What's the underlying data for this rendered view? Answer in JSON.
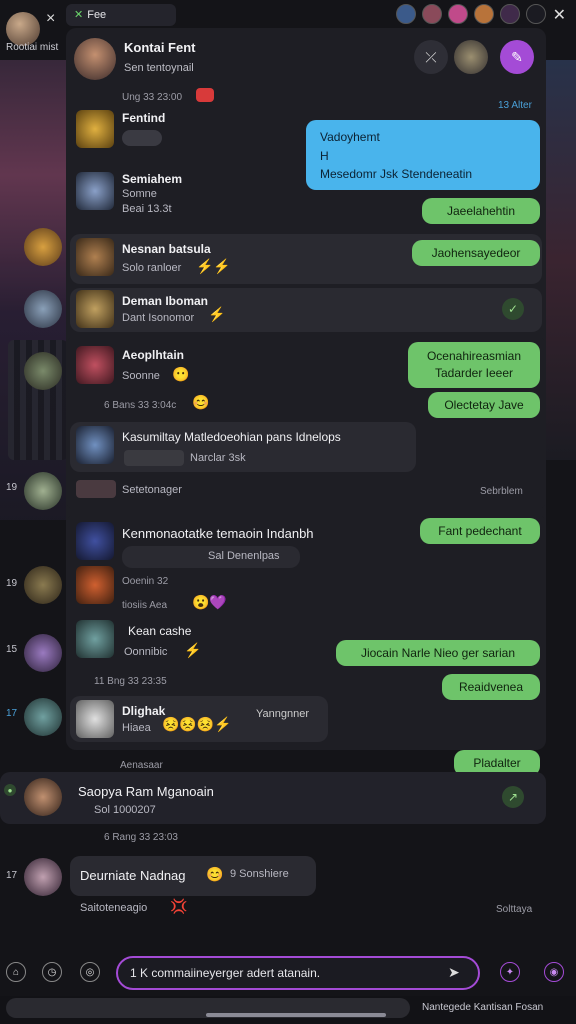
{
  "top": {
    "self_name": "Rootiai mist",
    "tab_label": "Fee",
    "close": "×"
  },
  "header": {
    "name": "Kontai Fent",
    "subtitle": "Sen tentoynail"
  },
  "items": [
    {
      "meta": "Ung 33 23:00"
    },
    {
      "name": "Fentind"
    },
    {
      "name": "Semiahem",
      "sub1": "Somne",
      "sub2": "Beai  13.3t"
    },
    {
      "name": "Nesnan batsula",
      "sub": "Solo ranloer"
    },
    {
      "name": "Deman Iboman",
      "sub": "Dant Isonomor"
    },
    {
      "name": "Aeoplhtain",
      "sub": "Soonne"
    },
    {
      "meta": "6 Bans 33 3:04c"
    },
    {
      "name": "Kasumiltay Matledoeohian pans Idnelops",
      "sub": "Narclar 3sk"
    },
    {
      "meta": "Setetonager"
    },
    {
      "name": "Kenmonaotatke temaoin Indanbh",
      "sub": "Sal Denenlpas"
    },
    {
      "meta": "Ooenin 32"
    },
    {
      "meta": "tiosiis Aea"
    },
    {
      "name": "Kean cashe",
      "sub": "Oonnibic"
    },
    {
      "meta": "11 Bng 33 23:35"
    },
    {
      "name": "Dlighak",
      "sub": "Hiaea",
      "right": "Yanngnner"
    },
    {
      "meta": "Aenasaar"
    },
    {
      "name": "Saopya Ram Mganoain",
      "sub": "Sol 1000207"
    },
    {
      "meta": "6 Rang 33 23:03"
    },
    {
      "name": "Deurniate Nadnag",
      "sub": "9 Sonshiere"
    },
    {
      "meta": "Saitoteneagio"
    }
  ],
  "outgoing": [
    "13 Alter",
    "Vadoyhemt\nH\nMesedomr Jsk Stendeneatin",
    "Jaeelahehtin",
    "Jaohensayedeor",
    "Ocenahireasmian Tadarder Ieeer",
    "Olectetay Jave",
    "Sebrblem",
    "Fant pedechant",
    "Jiocain Narle Nieo ger sarian",
    "Reaidvenea",
    "Pladalter",
    "Solttaya"
  ],
  "side_numbers": [
    "19",
    "19",
    "15",
    "17",
    "17"
  ],
  "composer": {
    "placeholder": "1 K commaiineyerger adert atanain."
  },
  "bottom_text": "Nantegede Kantisan Fosan",
  "colors": {
    "accent": "#a44bd6",
    "green": "#6ec46a",
    "blue": "#49b4ec"
  }
}
